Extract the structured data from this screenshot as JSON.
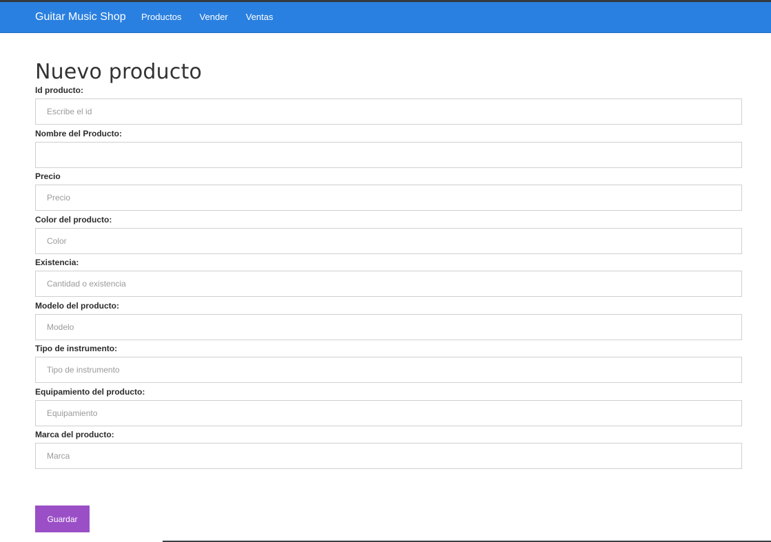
{
  "navbar": {
    "brand": "Guitar Music Shop",
    "links": [
      "Productos",
      "Vender",
      "Ventas"
    ],
    "color": "#2a80e0"
  },
  "page": {
    "title": "Nuevo producto"
  },
  "form": {
    "fields": [
      {
        "label": "Id producto:",
        "placeholder": "Escribe el id",
        "value": ""
      },
      {
        "label": "Nombre del Producto:",
        "placeholder": "",
        "value": ""
      },
      {
        "label": "Precio",
        "placeholder": "Precio",
        "value": ""
      },
      {
        "label": "Color del producto:",
        "placeholder": "Color",
        "value": ""
      },
      {
        "label": "Existencia:",
        "placeholder": "Cantidad o existencia",
        "value": ""
      },
      {
        "label": "Modelo del producto:",
        "placeholder": "Modelo",
        "value": ""
      },
      {
        "label": "Tipo de instrumento:",
        "placeholder": "Tipo de instrumento",
        "value": ""
      },
      {
        "label": "Equipamiento del producto:",
        "placeholder": "Equipamiento",
        "value": ""
      },
      {
        "label": "Marca del producto:",
        "placeholder": "Marca",
        "value": ""
      }
    ],
    "submit_label": "Guardar",
    "submit_color": "#9b4fc6"
  }
}
